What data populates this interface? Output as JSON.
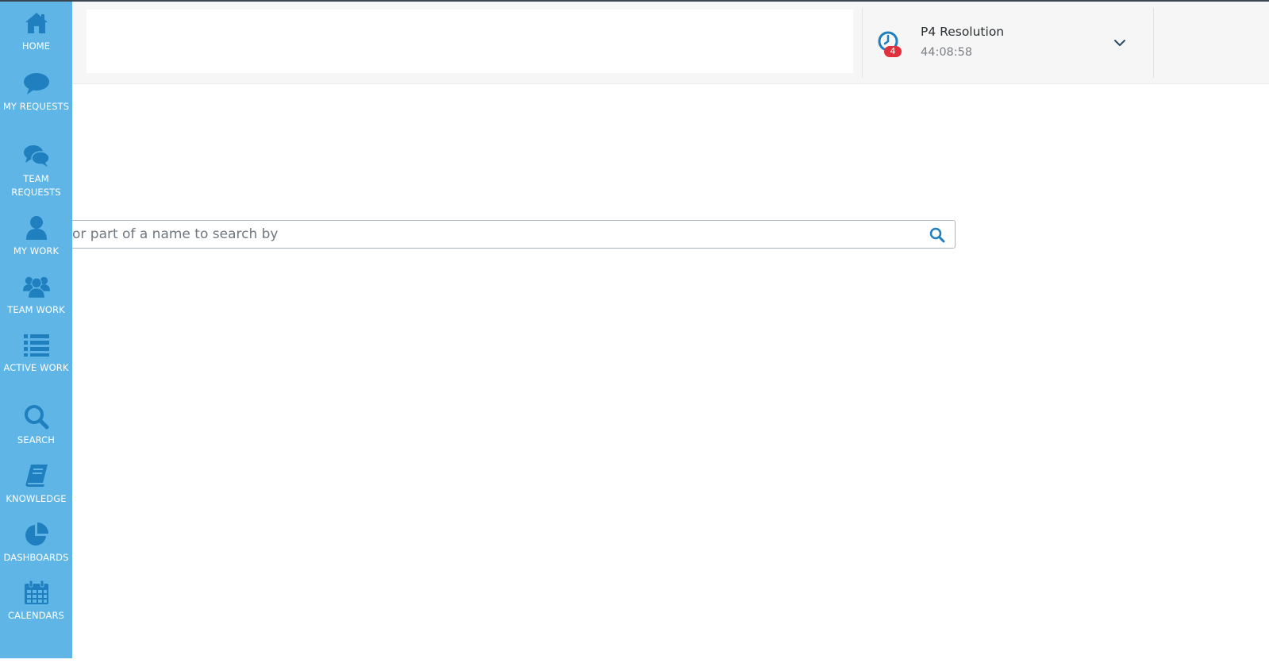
{
  "sidebar": {
    "items": [
      {
        "label": "HOME",
        "icon": "home-icon"
      },
      {
        "label": "MY REQUESTS",
        "icon": "speech-bubble-icon"
      },
      {
        "label": "TEAM REQUESTS",
        "icon": "speech-bubbles-icon"
      },
      {
        "label": "MY WORK",
        "icon": "user-icon"
      },
      {
        "label": "TEAM WORK",
        "icon": "users-icon"
      },
      {
        "label": "ACTIVE WORK",
        "icon": "list-icon"
      },
      {
        "label": "SEARCH",
        "icon": "search-icon"
      },
      {
        "label": "KNOWLEDGE",
        "icon": "book-icon"
      },
      {
        "label": "DASHBOARDS",
        "icon": "pie-chart-icon"
      },
      {
        "label": "CALENDARS",
        "icon": "calendar-icon"
      }
    ],
    "color": "#5fb6e6",
    "icon_color": "#1f7fbf"
  },
  "sla": {
    "title": "P4 Resolution",
    "time": "44:08:58",
    "badge": "4",
    "badge_color": "#e0313d",
    "icon": "clock-icon"
  },
  "search": {
    "placeholder": "or part of a name to search by",
    "value": ""
  }
}
